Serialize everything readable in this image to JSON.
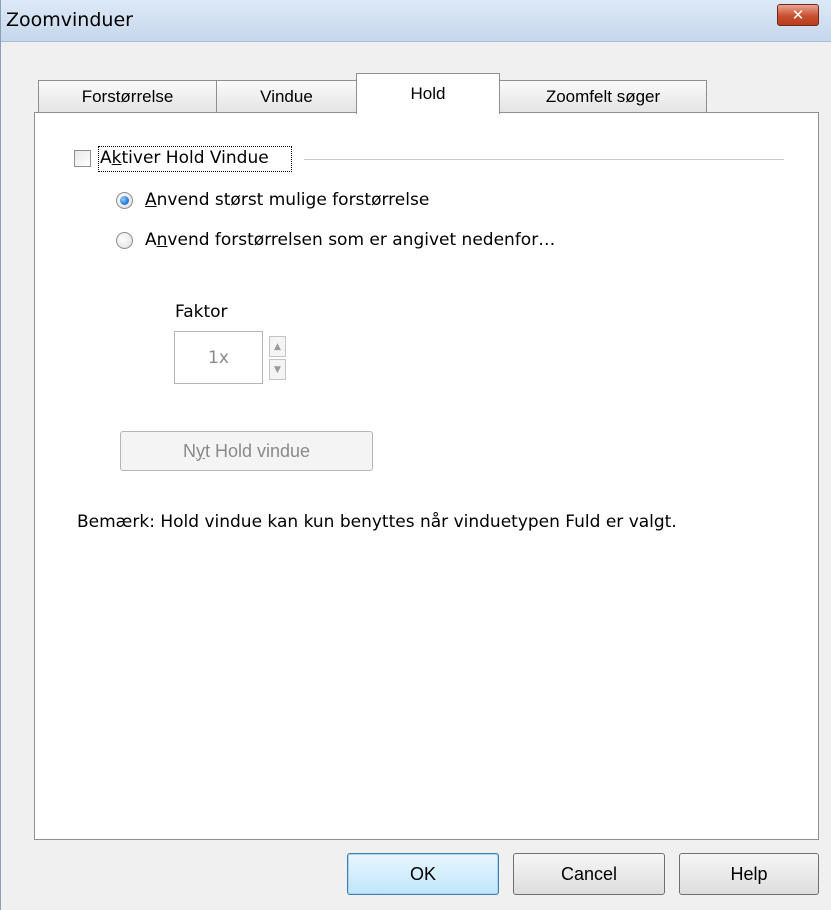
{
  "window": {
    "title": "Zoomvinduer",
    "close_glyph": "✕"
  },
  "tabs": [
    {
      "label": "Forstørrelse",
      "active": false
    },
    {
      "label": "Vindue",
      "active": false
    },
    {
      "label": "Hold",
      "active": true
    },
    {
      "label": "Zoomfelt søger",
      "active": false
    }
  ],
  "hold": {
    "enable_checkbox": {
      "label_prefix": "A",
      "label_accel": "k",
      "label_rest": "tiver Hold Vindue",
      "checked": false
    },
    "radio_largest": {
      "label_accel": "A",
      "label_rest": "nvend størst mulige forstørrelse",
      "checked": true
    },
    "radio_specified": {
      "label_prefix": "A",
      "label_accel": "n",
      "label_rest": "vend forstørrelsen som er angivet nedenfor…",
      "checked": false
    },
    "factor": {
      "label": "Faktor",
      "value": "1x",
      "up_glyph": "▲",
      "down_glyph": "▼"
    },
    "new_window_button": {
      "label_prefix": "N",
      "label_accel": "y",
      "label_rest": "t Hold vindue"
    },
    "note": "Bemærk: Hold vindue kan kun benyttes når vinduetypen Fuld er valgt."
  },
  "footer": {
    "ok": "OK",
    "cancel": "Cancel",
    "help": "Help"
  }
}
